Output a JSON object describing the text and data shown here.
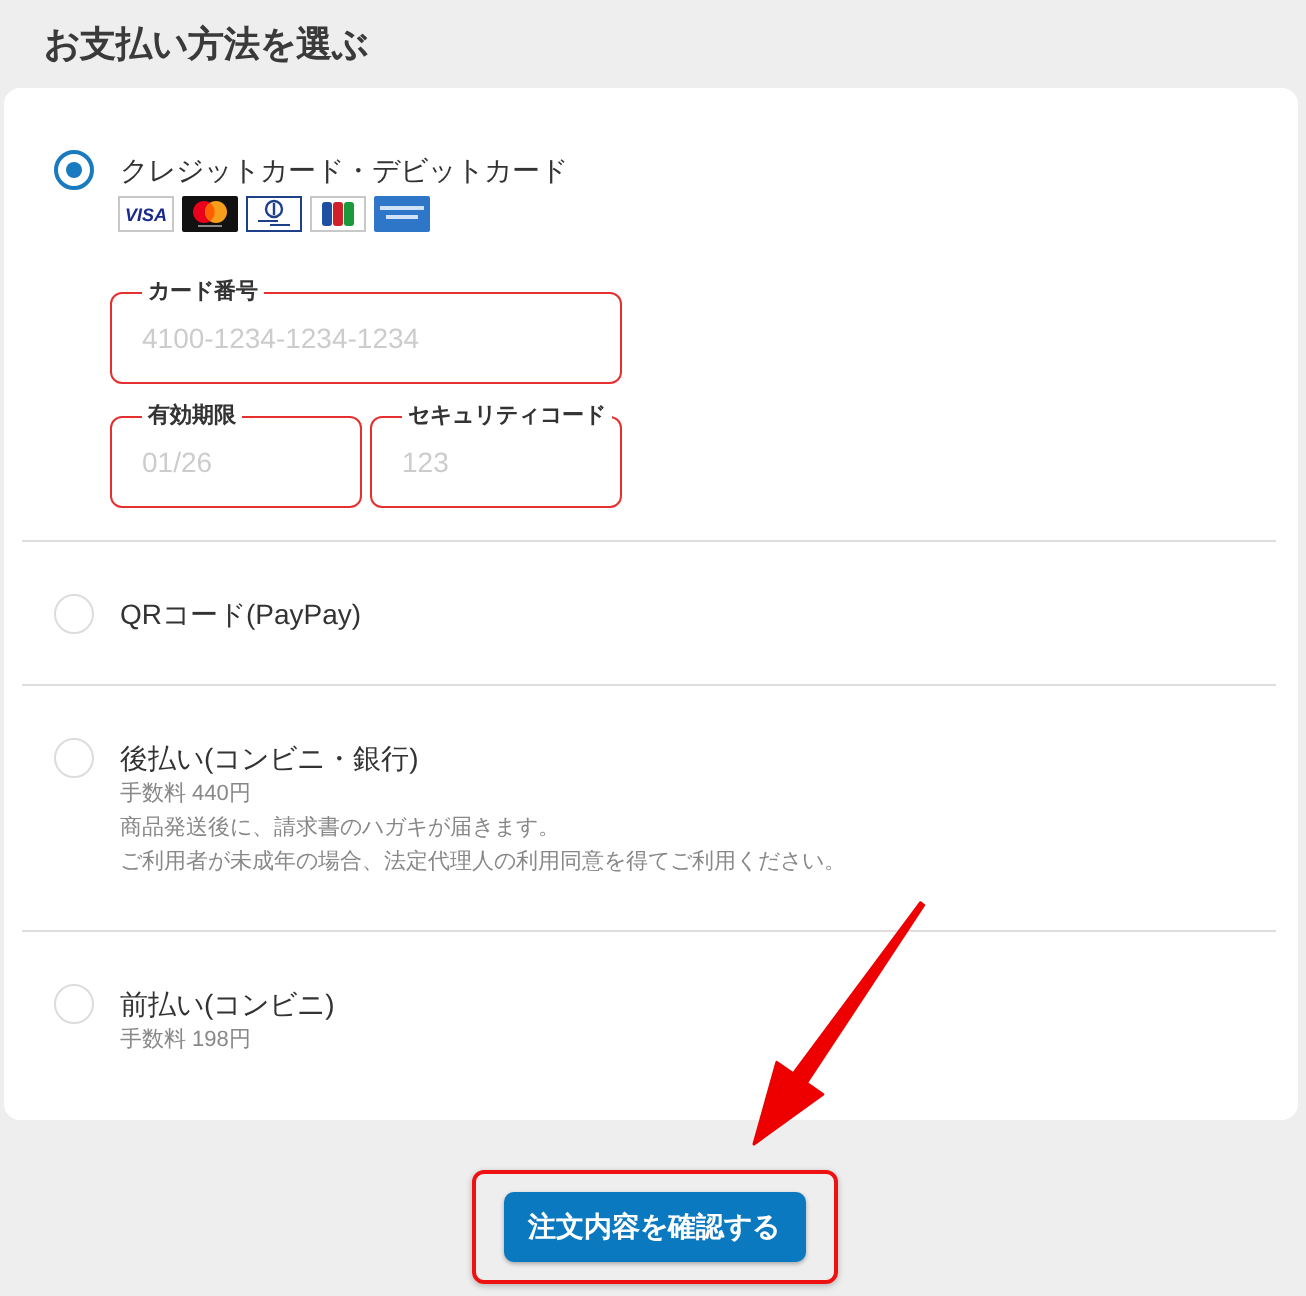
{
  "heading": "お支払い方法を選ぶ",
  "payment_methods": [
    {
      "label": "クレジットカード・デビットカード",
      "selected": true,
      "card_brands": [
        {
          "kind": "visa",
          "label": "VISA"
        },
        {
          "kind": "mastercard"
        },
        {
          "kind": "diners"
        },
        {
          "kind": "jcb"
        },
        {
          "kind": "amex"
        }
      ],
      "fields": [
        {
          "label": "カード番号",
          "placeholder": "4100-1234-1234-1234"
        },
        {
          "label": "有効期限",
          "placeholder": "01/26"
        },
        {
          "label": "セキュリティコード",
          "placeholder": "123"
        }
      ]
    },
    {
      "label": "QRコード(PayPay)",
      "selected": false
    },
    {
      "label": "後払い(コンビニ・銀行)",
      "selected": false,
      "notes": [
        "手数料 440円",
        "商品発送後に、請求書のハガキが届きます。",
        "ご利用者が未成年の場合、法定代理人の利用同意を得てご利用ください。"
      ]
    },
    {
      "label": "前払い(コンビニ)",
      "selected": false,
      "notes": [
        "手数料 198円"
      ]
    }
  ],
  "submit_button": {
    "label": "注文内容を確認する",
    "highlighted": true
  }
}
